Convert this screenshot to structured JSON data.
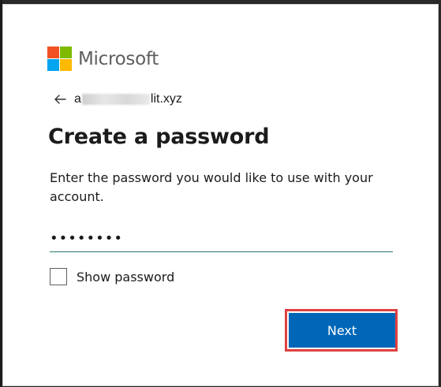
{
  "brand": {
    "name": "Microsoft",
    "colors": {
      "red": "#f25022",
      "green": "#7fba00",
      "blue": "#00a4ef",
      "yellow": "#ffb900"
    }
  },
  "identity": {
    "back_icon": "arrow-left-icon",
    "email_prefix": "a",
    "email_suffix": "lit.xyz"
  },
  "page": {
    "title": "Create a password",
    "description": "Enter the password you would like to use with your account."
  },
  "password": {
    "value": "••••••••",
    "underline_color": "#2a7a6a"
  },
  "show_password": {
    "label": "Show password",
    "checked": false
  },
  "next_button": {
    "label": "Next",
    "color": "#0067b8",
    "highlight_color": "#e04040"
  }
}
